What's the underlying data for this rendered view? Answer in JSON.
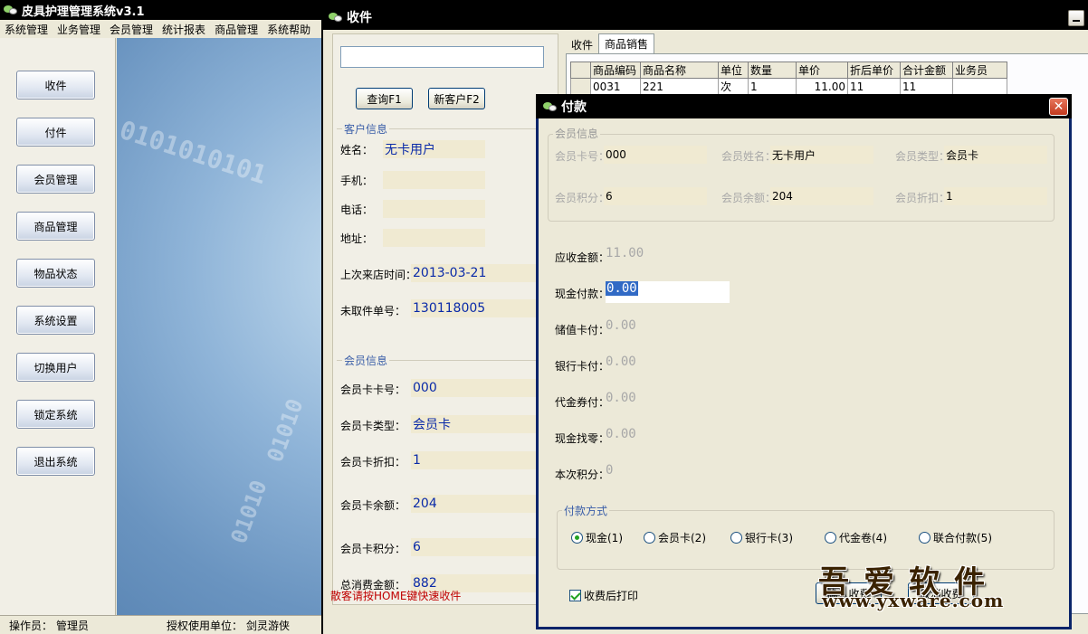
{
  "main_window": {
    "title": "皮具护理管理系统v3.1",
    "menu": [
      "系统管理",
      "业务管理",
      "会员管理",
      "统计报表",
      "商品管理",
      "系统帮助"
    ],
    "nav_buttons": [
      "收件",
      "付件",
      "会员管理",
      "商品管理",
      "物品状态",
      "系统设置",
      "切换用户",
      "锁定系统",
      "退出系统"
    ],
    "status_bar": {
      "operator_label": "操作员：",
      "operator": "管理员",
      "licensee_label": "授权使用单位：",
      "licensee": "剑灵游侠"
    }
  },
  "receive_window": {
    "title": "收件",
    "search_value": "",
    "query_button": "查询F1",
    "new_customer_button": "新客户F2",
    "customer_section": "客户信息",
    "customer": {
      "name_label": "姓名：",
      "name": "无卡用户",
      "mobile_label": "手机：",
      "mobile": "",
      "phone_label": "电话：",
      "phone": "",
      "address_label": "地址：",
      "address": "",
      "last_visit_label": "上次来店时间：",
      "last_visit": "2013-03-21",
      "pending_label": "未取件单号：",
      "pending": "130118005"
    },
    "member_section": "会员信息",
    "member": {
      "card_no_label": "会员卡卡号：",
      "card_no": "000",
      "card_type_label": "会员卡类型：",
      "card_type": "会员卡",
      "discount_label": "会员卡折扣：",
      "discount": "1",
      "balance_label": "会员卡余额：",
      "balance": "204",
      "points_label": "会员卡积分：",
      "points": "6",
      "total_label": "总消费金额：",
      "total": "882"
    },
    "footer_note": "散客请按HOME键快速收件",
    "tabs": [
      "收件",
      "商品销售"
    ],
    "active_tab": "商品销售",
    "grid": {
      "columns": [
        "商品编码",
        "商品名称",
        "单位",
        "数量",
        "单价",
        "折后单价",
        "合计金额",
        "业务员"
      ],
      "rows": [
        [
          "0031",
          "221",
          "次",
          "1",
          "11.00",
          "11",
          "11",
          ""
        ]
      ]
    }
  },
  "payment_dialog": {
    "title": "付款",
    "member_section": "会员信息",
    "member": {
      "card_no_label": "会员卡号：",
      "card_no": "000",
      "name_label": "会员姓名：",
      "name": "无卡用户",
      "type_label": "会员类型：",
      "type": "会员卡",
      "points_label": "会员积分：",
      "points": "6",
      "balance_label": "会员余额：",
      "balance": "204",
      "discount_label": "会员折扣：",
      "discount": "1"
    },
    "due_label": "应收金额：",
    "due": "11.00",
    "cash_label": "现金付款：",
    "cash": "0.00",
    "stored_label": "储值卡付：",
    "stored": "0.00",
    "bank_label": "银行卡付：",
    "bank": "0.00",
    "voucher_label": "代金券付：",
    "voucher": "0.00",
    "change_label": "现金找零：",
    "change": "0.00",
    "points_label": "本次积分：",
    "points_earned": "0",
    "method_section": "付款方式",
    "methods": [
      "现金(1)",
      "会员卡(2)",
      "银行卡(3)",
      "代金卷(4)",
      "联合付款(5)"
    ],
    "selected_method": "现金(1)",
    "print_after": "收费后打印",
    "confirm_button": "确认收费",
    "cancel_button": "取消收费"
  },
  "watermark": {
    "title": "吾爱软件",
    "url": "www.yxware.com"
  }
}
